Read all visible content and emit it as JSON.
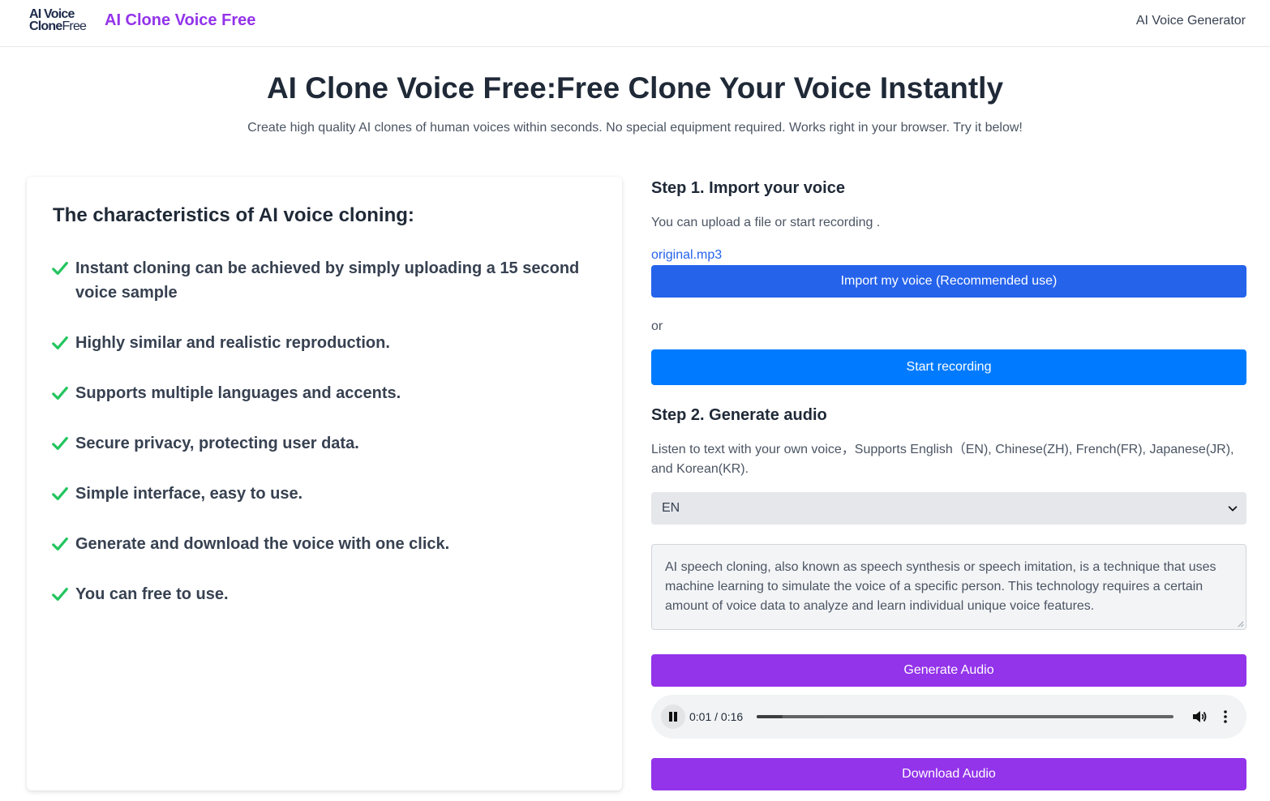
{
  "header": {
    "logo_line1": "AI Voice",
    "logo_line2_bold": "Clone",
    "logo_line2_light": "Free",
    "brand": "AI Clone Voice Free",
    "nav_link": "AI Voice Generator"
  },
  "hero": {
    "title": "AI Clone Voice Free:Free Clone Your Voice Instantly",
    "subtitle": "Create high quality AI clones of human voices within seconds. No special equipment required. Works right in your browser. Try it below!"
  },
  "features": {
    "heading": "The characteristics of AI voice cloning:",
    "items": [
      "Instant cloning can be achieved by simply uploading a 15 second voice sample",
      "Highly similar and realistic reproduction.",
      "Supports multiple languages and accents.",
      "Secure privacy, protecting user data.",
      "Simple interface, easy to use.",
      "Generate and download the voice with one click.",
      "You can free to use."
    ],
    "check_color": "#22c55e"
  },
  "step1": {
    "title": "Step 1. Import your voice",
    "description": "You can upload a file or start recording .",
    "file_name": "original.mp3",
    "import_button": "Import my voice (Recommended use)",
    "or_label": "or",
    "record_button": "Start recording"
  },
  "step2": {
    "title": "Step 2. Generate audio",
    "description": "Listen to text with your own voice，Supports English（EN), Chinese(ZH), French(FR), Japanese(JR), and Korean(KR).",
    "language_selected": "EN",
    "text": "AI speech cloning, also known as speech synthesis or speech imitation, is a technique that uses machine learning to simulate the voice of a specific person. This technology requires a certain amount of voice data to analyze and learn individual unique voice features.",
    "generate_button": "Generate Audio",
    "download_button": "Download Audio"
  },
  "player": {
    "time_display": "0:01 / 0:16",
    "progress_fraction": 0.0625,
    "state": "playing",
    "icons": [
      "pause-icon",
      "volume-icon",
      "more-options-icon"
    ]
  },
  "colors": {
    "brand_purple": "#9333ea",
    "primary_blue": "#2563eb",
    "record_blue": "#007bff",
    "check_green": "#22c55e"
  }
}
